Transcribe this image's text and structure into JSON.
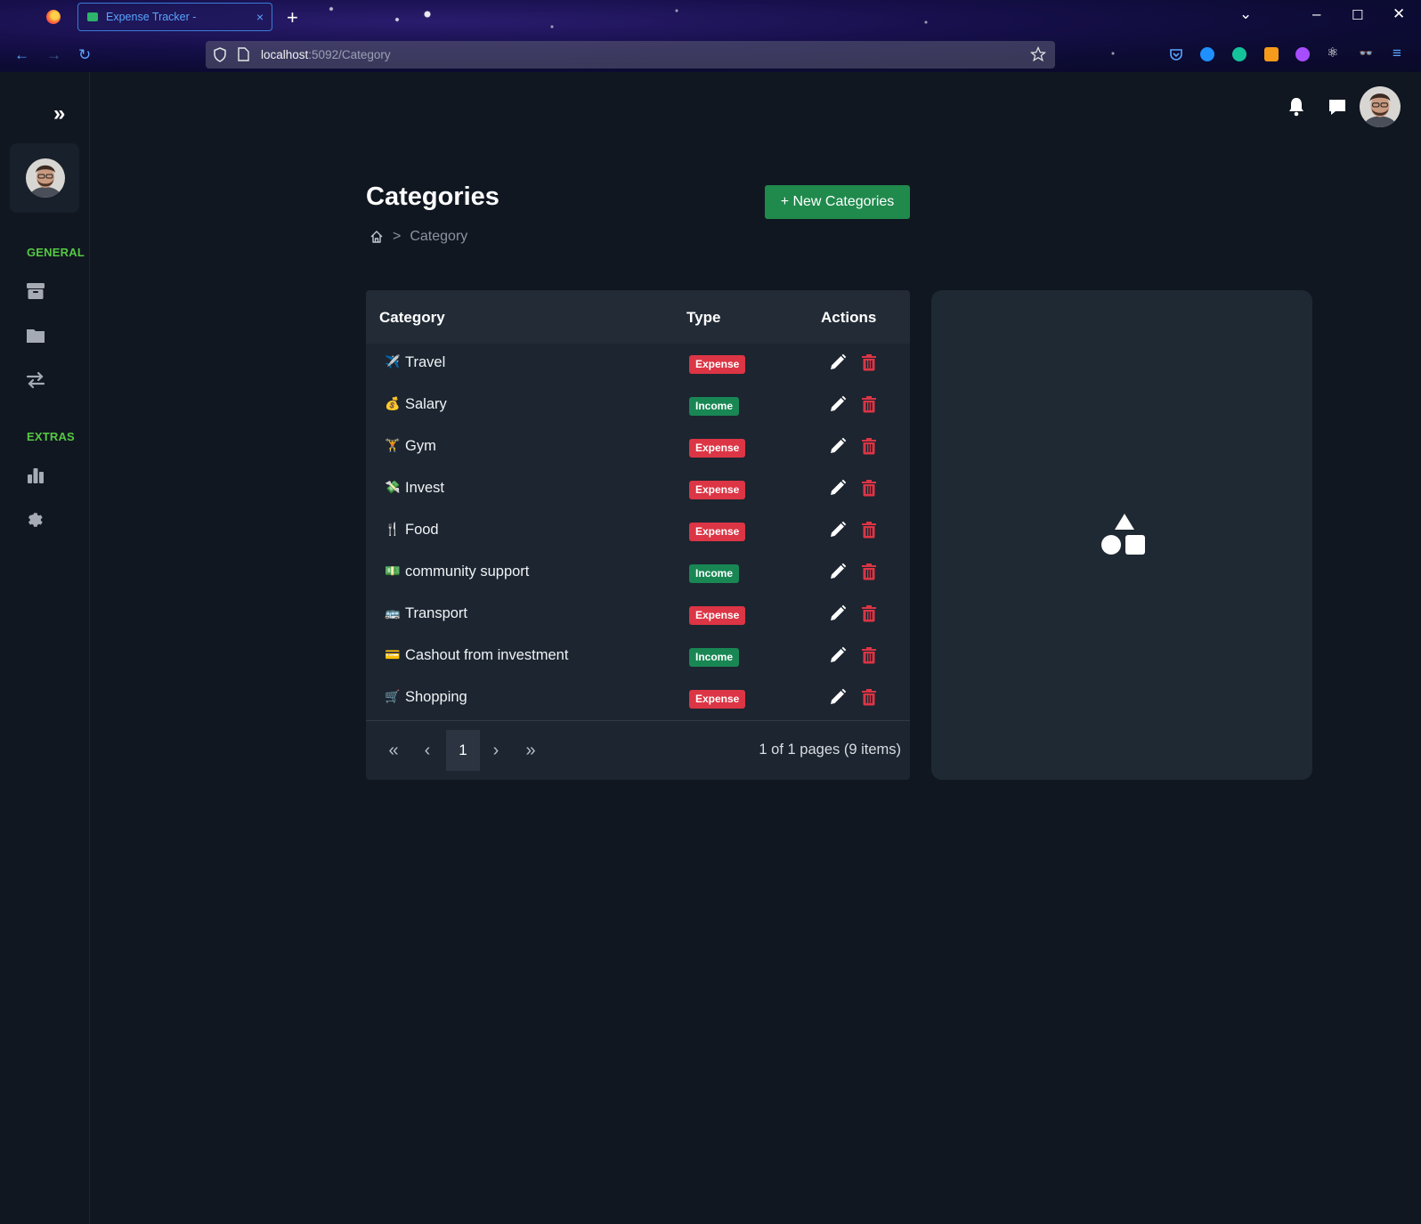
{
  "browser": {
    "tab_title": "Expense Tracker -",
    "tab_close": "×",
    "new_tab": "+",
    "url_host": "localhost",
    "url_path": ":5092/Category",
    "window_controls": [
      "⌄",
      "–",
      "☐",
      "✕"
    ]
  },
  "sidebar": {
    "toggle": "»",
    "sections": [
      {
        "label": "GENERAL",
        "items": [
          "box-icon",
          "folder-icon",
          "transfer-icon"
        ]
      },
      {
        "label": "EXTRAS",
        "items": [
          "bar-chart-icon",
          "gear-icon"
        ]
      }
    ]
  },
  "header": {
    "icons": [
      "bell-icon",
      "chat-icon",
      "avatar"
    ]
  },
  "page": {
    "title": "Categories",
    "new_button": "+ New Categories",
    "breadcrumb": {
      "sep": ">",
      "current": "Category"
    }
  },
  "grid": {
    "columns": [
      "Category",
      "Type",
      "Actions"
    ],
    "rows": [
      {
        "icon": "✈️",
        "name": "Travel",
        "type": "Expense"
      },
      {
        "icon": "💰",
        "name": "Salary",
        "type": "Income"
      },
      {
        "icon": "🏋",
        "name": "Gym",
        "type": "Expense"
      },
      {
        "icon": "💸",
        "name": "Invest",
        "type": "Expense"
      },
      {
        "icon": "🍴",
        "name": "Food",
        "type": "Expense"
      },
      {
        "icon": "💵",
        "name": "community support",
        "type": "Income"
      },
      {
        "icon": "🚌",
        "name": "Transport",
        "type": "Expense"
      },
      {
        "icon": "💳",
        "name": "Cashout from investment",
        "type": "Income"
      },
      {
        "icon": "🛒",
        "name": "Shopping",
        "type": "Expense"
      }
    ],
    "pager": {
      "first": "«",
      "prev": "‹",
      "current_page": "1",
      "next": "›",
      "last": "»",
      "info": "1 of 1 pages (9 items)"
    }
  },
  "colors": {
    "accent_green": "#1f8a4c",
    "expense_badge": "#dc3545",
    "income_badge": "#198754",
    "section_label": "#55c943",
    "page_bg": "#111721"
  }
}
